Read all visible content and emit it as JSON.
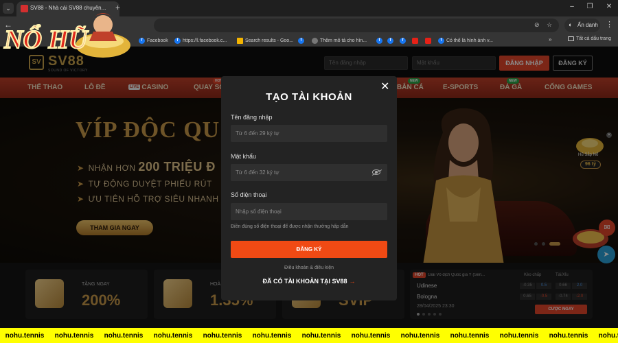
{
  "browser": {
    "tab_title": "SV88 - Nhà cái SV88 chuyên...",
    "incognito_label": "Ẩn danh",
    "bookmarks": [
      {
        "label": "Facebook",
        "icon": "facebook-icon"
      },
      {
        "label": "https://l.facebook.c...",
        "icon": "facebook-icon"
      },
      {
        "label": "Search results - Goo...",
        "icon": "drive-icon"
      },
      {
        "label": "",
        "icon": "facebook-icon"
      },
      {
        "label": "Thêm mô tả cho hìn...",
        "icon": "globe-icon"
      },
      {
        "label": "",
        "icon": "facebook-icon"
      },
      {
        "label": "",
        "icon": "facebook-icon"
      },
      {
        "label": "",
        "icon": "facebook-icon"
      },
      {
        "label": "",
        "icon": "youtube-icon"
      },
      {
        "label": "",
        "icon": "youtube-icon"
      },
      {
        "label": "Có thể là hình ảnh v...",
        "icon": "facebook-icon"
      }
    ],
    "all_bookmarks": "Tất cả dấu trang"
  },
  "logo_overlay": {
    "text": "NỔ HŨ"
  },
  "site": {
    "brand": "SV88",
    "brand_tagline": "SOUND OF VICTORY",
    "header": {
      "username_placeholder": "Tên đăng nhập",
      "password_placeholder": "Mật khẩu",
      "login_label": "ĐĂNG NHẬP",
      "register_label": "ĐĂNG KÝ"
    },
    "nav": [
      {
        "label": "THỂ THAO"
      },
      {
        "label": "LÔ ĐỀ"
      },
      {
        "label": "CASINO",
        "live": "LIVE"
      },
      {
        "label": "QUAY SỐ",
        "badge": "HOT"
      },
      {
        "label": "BẮN CÁ",
        "badge": "NEW"
      },
      {
        "label": "E-SPORTS"
      },
      {
        "label": "ĐÁ GÀ",
        "badge": "NEW"
      },
      {
        "label": "CỔNG GAMES"
      }
    ],
    "banner": {
      "title": "VÍP ĐỘC QU",
      "point1_prefix": "NHẬN HƠN",
      "point1_big": "200 TRIỆU Đ",
      "point2": "TỰ ĐỘNG DUYỆT PHIẾU RÚT",
      "point3": "ƯU TIÊN HỖ TRỢ SIÊU NHANH",
      "cta": "THAM GIA NGAY"
    },
    "jackpot_widget": {
      "caption": "Hũ Sắp Nổ",
      "amount": "96 tỷ"
    },
    "promos": [
      {
        "label": "TẶNG NGAY",
        "value": "200%"
      },
      {
        "label": "HOÀ",
        "value": "1.35%"
      },
      {
        "label": "",
        "value": "SVIP"
      }
    ],
    "match": {
      "hot": "HOT",
      "league": "Giải Vô địch Quốc gia Ý (Seri...",
      "col_handicap": "Kèo chấp",
      "col_overunder": "Tài/Xỉu",
      "home": "Udinese",
      "away": "Bologna",
      "home_odds": [
        "-0.35",
        "0.5",
        "0.66",
        "2.0"
      ],
      "away_odds": [
        "0.65",
        "-0.5",
        "-0.74",
        "-2.0"
      ],
      "datetime": "28/04/2025 23:30",
      "bet_label": "CƯỢC NGAY"
    }
  },
  "modal": {
    "title": "TẠO TÀI KHOẢN",
    "username_label": "Tên đăng nhập",
    "username_placeholder": "Từ 6 đến 29 ký tự",
    "password_label": "Mật khẩu",
    "password_placeholder": "Từ 6 đến 32 ký tự",
    "phone_label": "Số điện thoại",
    "phone_placeholder": "Nhập số điện thoại",
    "phone_hint": "Điền đúng số điện thoại để được nhận thưởng hấp dẫn",
    "submit_label": "ĐĂNG KÝ",
    "terms_label": "Điều khoản & điều kiện",
    "login_link": "ĐÃ CÓ TÀI KHOẢN TẠI SV88",
    "login_arrow": "→"
  },
  "ticker": {
    "text": "nohu.tennis",
    "count": 13
  }
}
